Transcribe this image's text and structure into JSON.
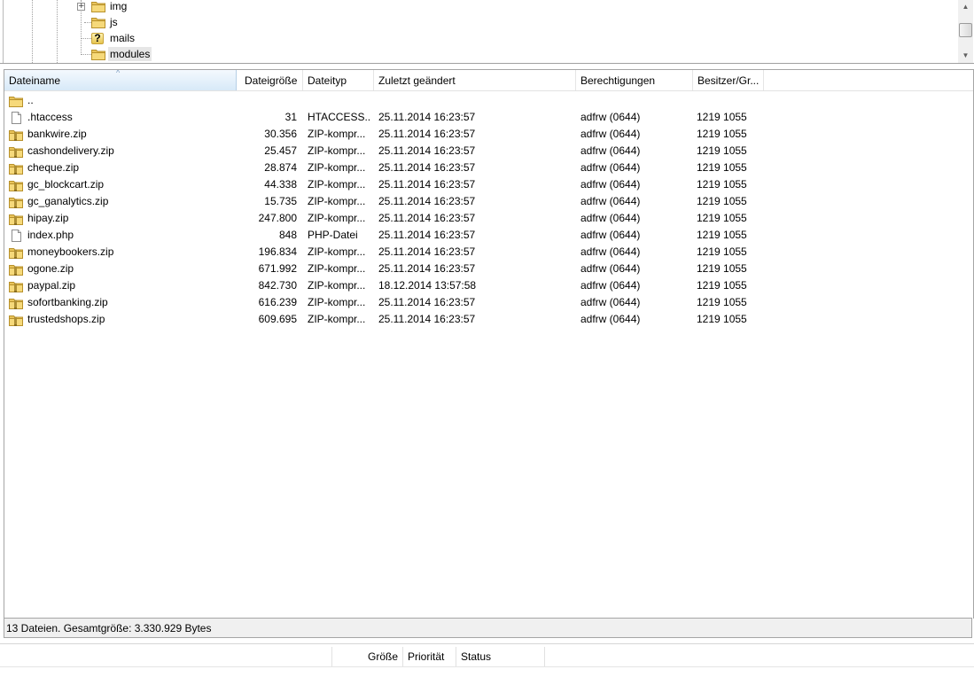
{
  "tree": {
    "items": [
      {
        "name": "img",
        "icon": "folder-icon",
        "expandable": true
      },
      {
        "name": "js",
        "icon": "folder-icon",
        "expandable": false
      },
      {
        "name": "mails",
        "icon": "unknown-folder-icon",
        "expandable": false
      },
      {
        "name": "modules",
        "icon": "folder-icon",
        "expandable": false,
        "selected": true
      }
    ]
  },
  "columns": {
    "name": "Dateiname",
    "size": "Dateigröße",
    "type": "Dateityp",
    "modified": "Zuletzt geändert",
    "permissions": "Berechtigungen",
    "owner": "Besitzer/Gr..."
  },
  "files": [
    {
      "name": "..",
      "size": "",
      "type": "",
      "modified": "",
      "permissions": "",
      "owner": "",
      "icon": "folder-icon"
    },
    {
      "name": ".htaccess",
      "size": "31",
      "type": "HTACCESS...",
      "modified": "25.11.2014 16:23:57",
      "permissions": "adfrw (0644)",
      "owner": "1219 1055",
      "icon": "file-icon"
    },
    {
      "name": "bankwire.zip",
      "size": "30.356",
      "type": "ZIP-kompr...",
      "modified": "25.11.2014 16:23:57",
      "permissions": "adfrw (0644)",
      "owner": "1219 1055",
      "icon": "zip-folder-icon"
    },
    {
      "name": "cashondelivery.zip",
      "size": "25.457",
      "type": "ZIP-kompr...",
      "modified": "25.11.2014 16:23:57",
      "permissions": "adfrw (0644)",
      "owner": "1219 1055",
      "icon": "zip-folder-icon"
    },
    {
      "name": "cheque.zip",
      "size": "28.874",
      "type": "ZIP-kompr...",
      "modified": "25.11.2014 16:23:57",
      "permissions": "adfrw (0644)",
      "owner": "1219 1055",
      "icon": "zip-folder-icon"
    },
    {
      "name": "gc_blockcart.zip",
      "size": "44.338",
      "type": "ZIP-kompr...",
      "modified": "25.11.2014 16:23:57",
      "permissions": "adfrw (0644)",
      "owner": "1219 1055",
      "icon": "zip-folder-icon"
    },
    {
      "name": "gc_ganalytics.zip",
      "size": "15.735",
      "type": "ZIP-kompr...",
      "modified": "25.11.2014 16:23:57",
      "permissions": "adfrw (0644)",
      "owner": "1219 1055",
      "icon": "zip-folder-icon"
    },
    {
      "name": "hipay.zip",
      "size": "247.800",
      "type": "ZIP-kompr...",
      "modified": "25.11.2014 16:23:57",
      "permissions": "adfrw (0644)",
      "owner": "1219 1055",
      "icon": "zip-folder-icon"
    },
    {
      "name": "index.php",
      "size": "848",
      "type": "PHP-Datei",
      "modified": "25.11.2014 16:23:57",
      "permissions": "adfrw (0644)",
      "owner": "1219 1055",
      "icon": "file-icon"
    },
    {
      "name": "moneybookers.zip",
      "size": "196.834",
      "type": "ZIP-kompr...",
      "modified": "25.11.2014 16:23:57",
      "permissions": "adfrw (0644)",
      "owner": "1219 1055",
      "icon": "zip-folder-icon"
    },
    {
      "name": "ogone.zip",
      "size": "671.992",
      "type": "ZIP-kompr...",
      "modified": "25.11.2014 16:23:57",
      "permissions": "adfrw (0644)",
      "owner": "1219 1055",
      "icon": "zip-folder-icon"
    },
    {
      "name": "paypal.zip",
      "size": "842.730",
      "type": "ZIP-kompr...",
      "modified": "18.12.2014 13:57:58",
      "permissions": "adfrw (0644)",
      "owner": "1219 1055",
      "icon": "zip-folder-icon"
    },
    {
      "name": "sofortbanking.zip",
      "size": "616.239",
      "type": "ZIP-kompr...",
      "modified": "25.11.2014 16:23:57",
      "permissions": "adfrw (0644)",
      "owner": "1219 1055",
      "icon": "zip-folder-icon"
    },
    {
      "name": "trustedshops.zip",
      "size": "609.695",
      "type": "ZIP-kompr...",
      "modified": "25.11.2014 16:23:57",
      "permissions": "adfrw (0644)",
      "owner": "1219 1055",
      "icon": "zip-folder-icon"
    }
  ],
  "status": {
    "text": "13 Dateien. Gesamtgröße: 3.330.929 Bytes"
  },
  "queue": {
    "columns": [
      "Größe",
      "Priorität",
      "Status"
    ]
  },
  "colors": {
    "folder": "#e8c35a",
    "selected_header": "#d7e9f8"
  }
}
